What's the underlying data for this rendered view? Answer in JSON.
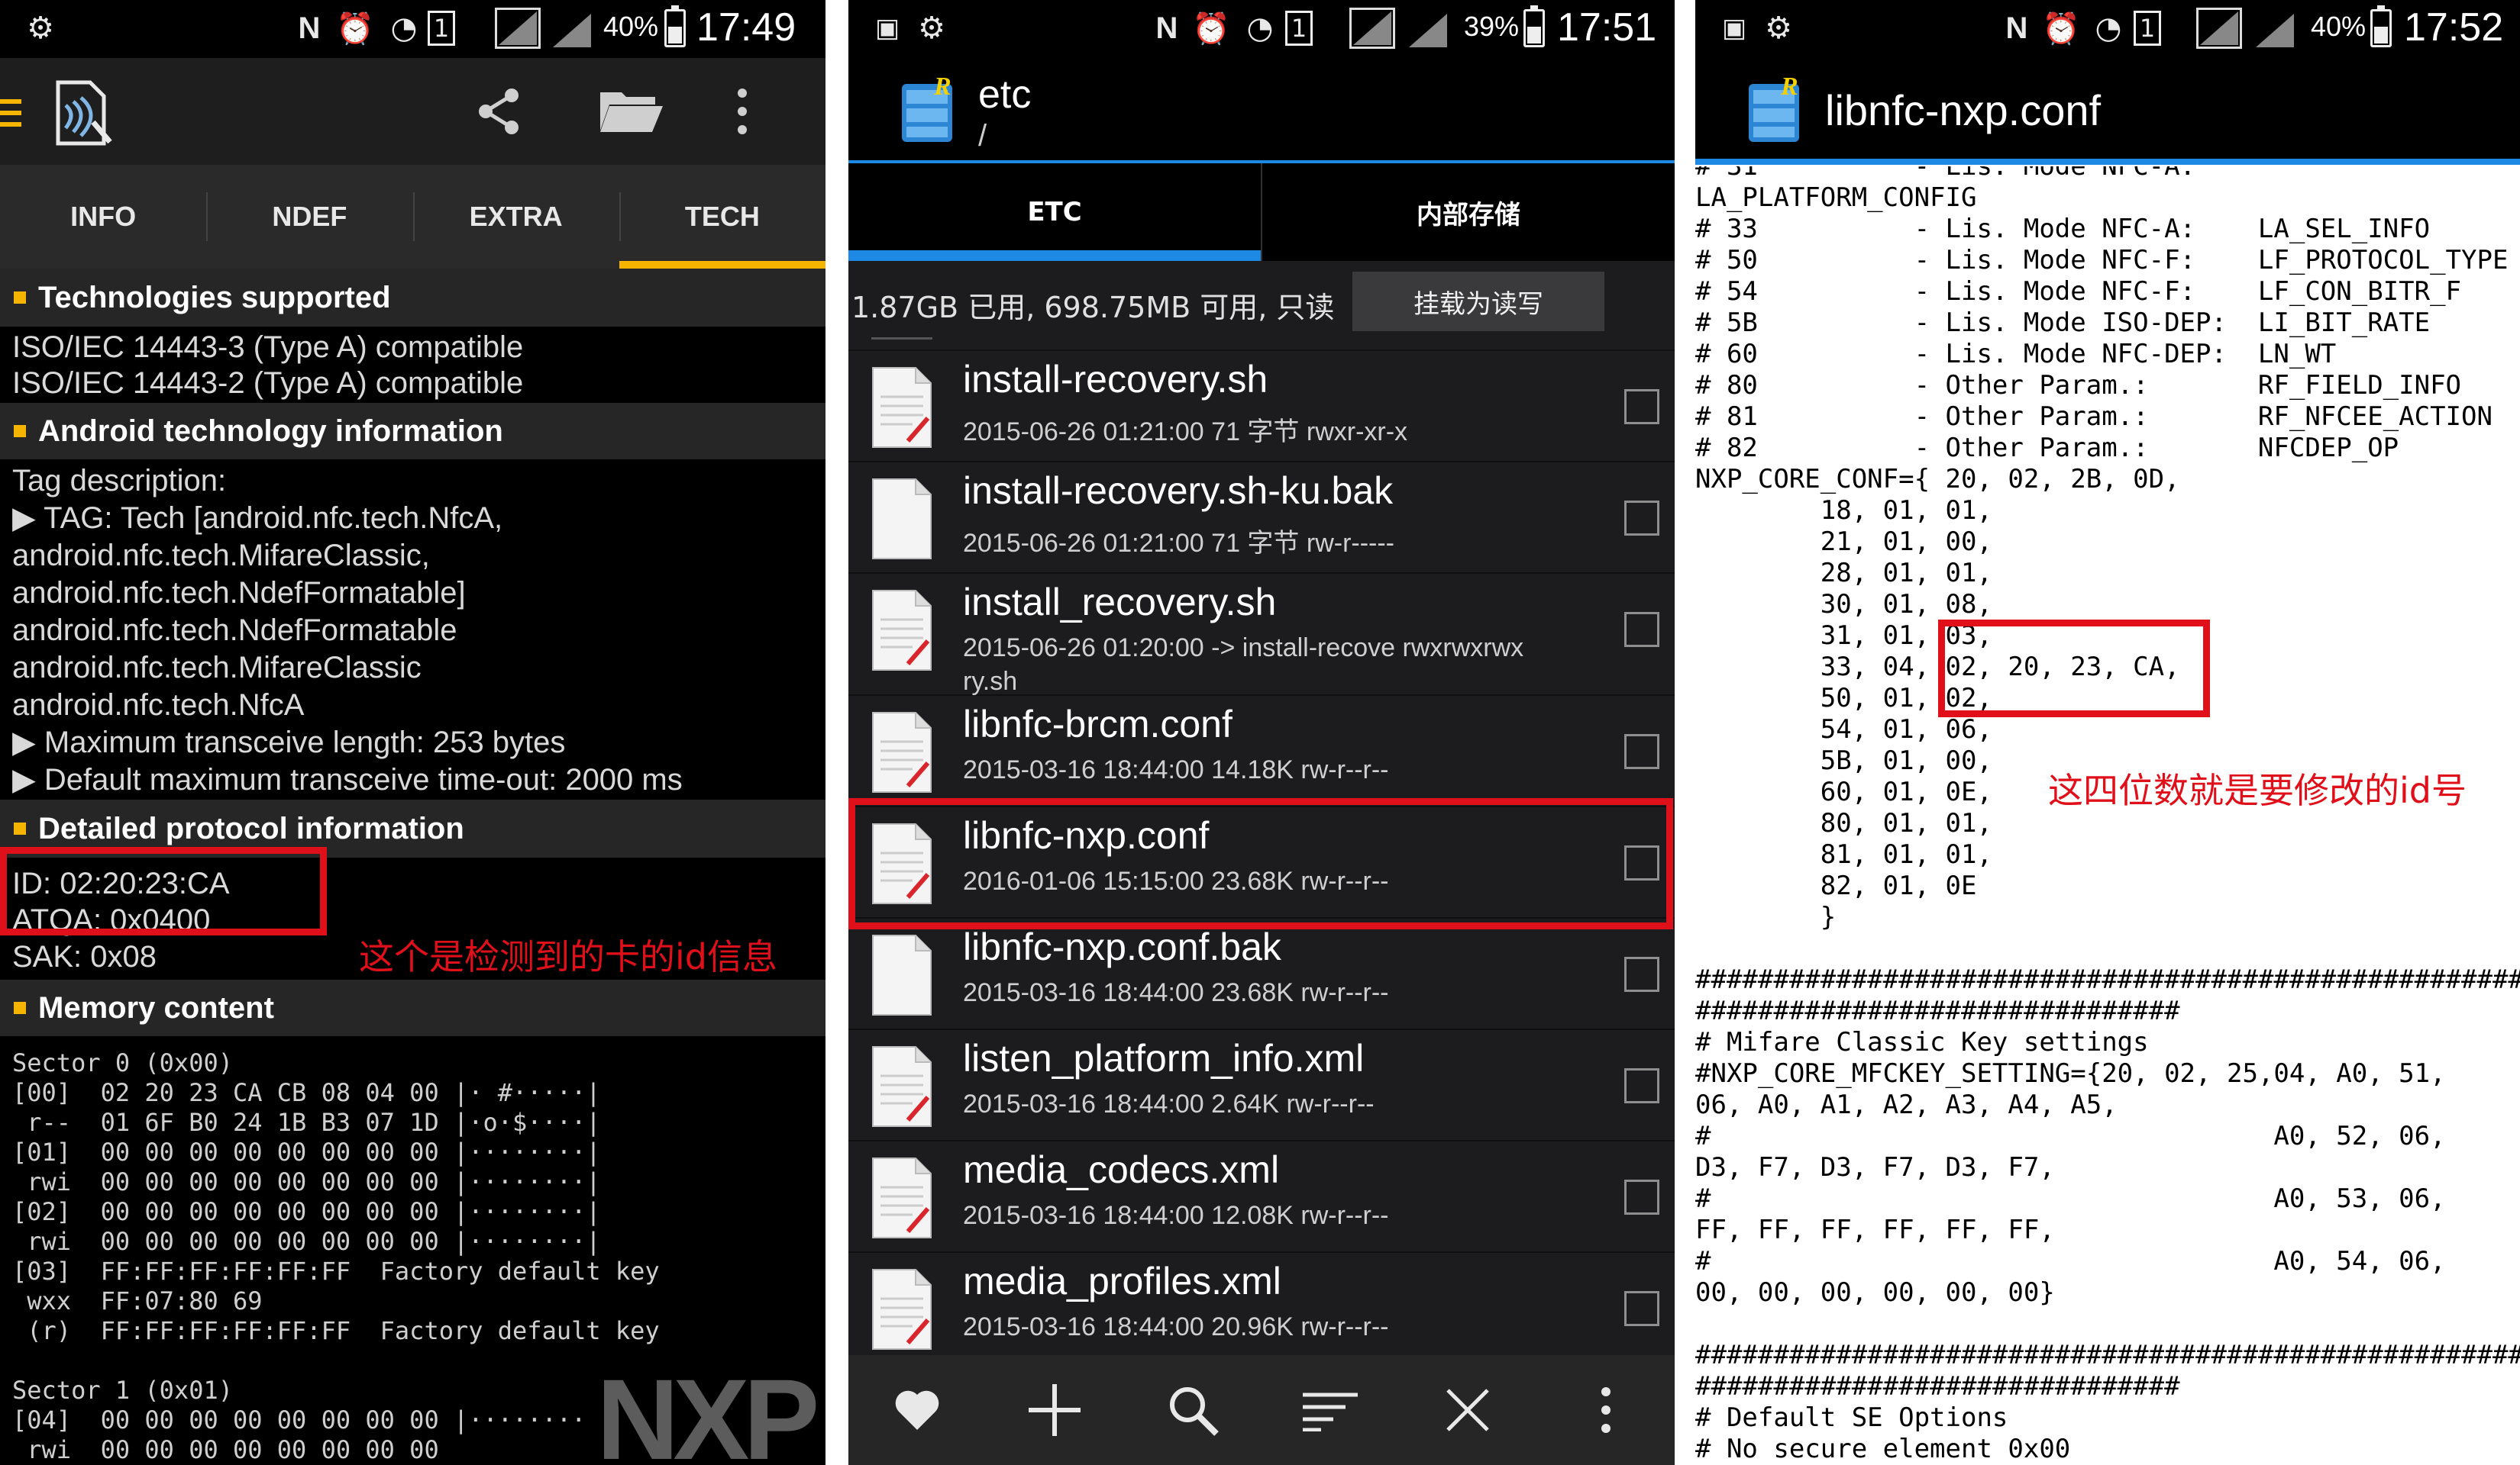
{
  "panel1": {
    "status": {
      "battery": "40%",
      "time": "17:49"
    },
    "tabs": [
      "INFO",
      "NDEF",
      "EXTRA",
      "TECH"
    ],
    "active_tab": "TECH",
    "sections": {
      "tech_title": "Technologies supported",
      "tech_lines": [
        "ISO/IEC 14443-3 (Type A) compatible",
        "ISO/IEC 14443-2 (Type A) compatible"
      ],
      "android_title": "Android technology information",
      "android_lines": [
        "Tag description:",
        "▶ TAG: Tech [android.nfc.tech.NfcA,",
        "android.nfc.tech.MifareClassic,",
        "android.nfc.tech.NdefFormatable]",
        "android.nfc.tech.NdefFormatable",
        "android.nfc.tech.MifareClassic",
        "android.nfc.tech.NfcA",
        "▶ Maximum transceive length: 253 bytes",
        "▶ Default maximum transceive time-out: 2000 ms"
      ],
      "detailed_title": "Detailed protocol information",
      "id_line": "ID: 02:20:23:CA",
      "atqa_line": "ATQA: 0x0400",
      "sak_line": "SAK: 0x08",
      "memory_title": "Memory content",
      "memory_dump": "Sector 0 (0x00)\n[00]  02 20 23 CA CB 08 04 00 |· #·····|\n r--  01 6F B0 24 1B B3 07 1D |·o·$····|\n[01]  00 00 00 00 00 00 00 00 |········|\n rwi  00 00 00 00 00 00 00 00 |········|\n[02]  00 00 00 00 00 00 00 00 |········|\n rwi  00 00 00 00 00 00 00 00 |········|\n[03]  FF:FF:FF:FF:FF:FF  Factory default key\n wxx  FF:07:80 69\n (r)  FF:FF:FF:FF:FF:FF  Factory default key\n\nSector 1 (0x01)\n[04]  00 00 00 00 00 00 00 00 |········\n rwi  00 00 00 00 00 00 00 00"
    },
    "annotation": "这个是检测到的卡的id信息",
    "watermark": "NXP"
  },
  "panel2": {
    "status": {
      "battery": "39%",
      "time": "17:51"
    },
    "title": "etc",
    "path": "/",
    "tabs": [
      "ETC",
      "内部存储"
    ],
    "active_tab": "ETC",
    "storage_text": "1.87GB 已用, 698.75MB 可用, 只读",
    "mount_button": "挂载为读写",
    "files": [
      {
        "name": "install-recovery.sh",
        "meta": "2015-06-26 01:21:00  71 字节  rwxr-xr-x",
        "meta2": "",
        "icon": "script"
      },
      {
        "name": "install-recovery.sh-ku.bak",
        "meta": "2015-06-26 01:21:00  71 字节  rw-r-----",
        "meta2": "",
        "icon": "blank"
      },
      {
        "name": "install_recovery.sh",
        "meta": "2015-06-26 01:20:00  -> install-recove  rwxrwxrwx",
        "meta2": "ry.sh",
        "icon": "script"
      },
      {
        "name": "libnfc-brcm.conf",
        "meta": "2015-03-16 18:44:00  14.18K  rw-r--r--",
        "meta2": "",
        "icon": "script"
      },
      {
        "name": "libnfc-nxp.conf",
        "meta": "2016-01-06 15:15:00  23.68K  rw-r--r--",
        "meta2": "",
        "icon": "script"
      },
      {
        "name": "libnfc-nxp.conf.bak",
        "meta": "2015-03-16 18:44:00  23.68K  rw-r--r--",
        "meta2": "",
        "icon": "blank"
      },
      {
        "name": "listen_platform_info.xml",
        "meta": "2015-03-16 18:44:00  2.64K  rw-r--r--",
        "meta2": "",
        "icon": "script"
      },
      {
        "name": "media_codecs.xml",
        "meta": "2015-03-16 18:44:00  12.08K  rw-r--r--",
        "meta2": "",
        "icon": "script"
      },
      {
        "name": "media_profiles.xml",
        "meta": "2015-03-16 18:44:00  20.96K  rw-r--r--",
        "meta2": "",
        "icon": "script"
      }
    ],
    "bottom_icons": [
      "heart-icon",
      "plus-icon",
      "search-icon",
      "sort-icon",
      "close-icon",
      "more-icon"
    ]
  },
  "panel3": {
    "status": {
      "battery": "40%",
      "time": "17:52"
    },
    "title": "libnfc-nxp.conf",
    "file_text": "# 31          - Lis. Mode NFC-A:\nLA_PLATFORM_CONFIG\n# 33          - Lis. Mode NFC-A:    LA_SEL_INFO\n# 50          - Lis. Mode NFC-F:    LF_PROTOCOL_TYPE\n# 54          - Lis. Mode NFC-F:    LF_CON_BITR_F\n# 5B          - Lis. Mode ISO-DEP:  LI_BIT_RATE\n# 60          - Lis. Mode NFC-DEP:  LN_WT\n# 80          - Other Param.:       RF_FIELD_INFO\n# 81          - Other Param.:       RF_NFCEE_ACTION\n# 82          - Other Param.:       NFCDEP_OP\nNXP_CORE_CONF={ 20, 02, 2B, 0D,\n        18, 01, 01,\n        21, 01, 00,\n        28, 01, 01,\n        30, 01, 08,\n        31, 01, 03,\n        33, 04, 02, 20, 23, CA,\n        50, 01, 02,\n        54, 01, 06,\n        5B, 01, 00,\n        60, 01, 0E,\n        80, 01, 01,\n        81, 01, 01,\n        82, 01, 0E\n        }\n\n##############################################################\n###############################\n# Mifare Classic Key settings\n#NXP_CORE_MFCKEY_SETTING={20, 02, 25,04, A0, 51,\n06, A0, A1, A2, A3, A4, A5,\n#                                    A0, 52, 06,\nD3, F7, D3, F7, D3, F7,\n#                                    A0, 53, 06,\nFF, FF, FF, FF, FF, FF,\n#                                    A0, 54, 06,\n00, 00, 00, 00, 00, 00}\n\n##############################################################\n###############################\n# Default SE Options\n# No secure element 0x00",
    "annotation": "这四位数就是要修改的id号"
  },
  "colors": {
    "accent_yellow": "#f5b400",
    "accent_blue": "#1e88e5",
    "annotation_red": "#e0101a"
  }
}
